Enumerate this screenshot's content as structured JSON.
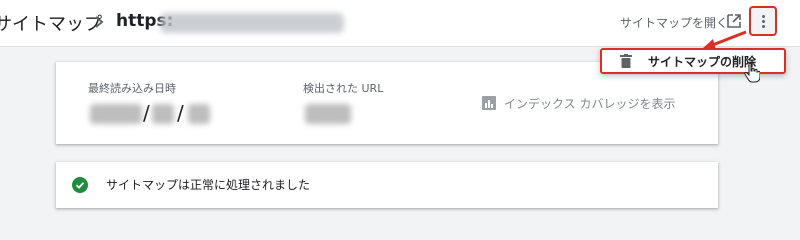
{
  "header": {
    "title": "サイトマップ",
    "url_prefix": "https:",
    "open_sitemap_label": "サイトマップを開く",
    "more_icon": "more-vert-icon",
    "open_icon": "open-in-new-icon"
  },
  "menu": {
    "delete_label": "サイトマップの削除",
    "delete_icon": "trash-icon"
  },
  "summary": {
    "last_read_label": "最終読み込み日時",
    "last_read_sep1": "/",
    "last_read_sep2": "/",
    "detected_urls_label": "検出された URL",
    "coverage_link": "インデックス カバレッジを表示",
    "coverage_icon": "bar-chart-icon"
  },
  "status": {
    "message": "サイトマップは正常に処理されました",
    "icon": "check-circle-icon",
    "color": "#1e8e3e"
  },
  "colors": {
    "highlight": "#d93025",
    "background": "#f1f3f4"
  }
}
